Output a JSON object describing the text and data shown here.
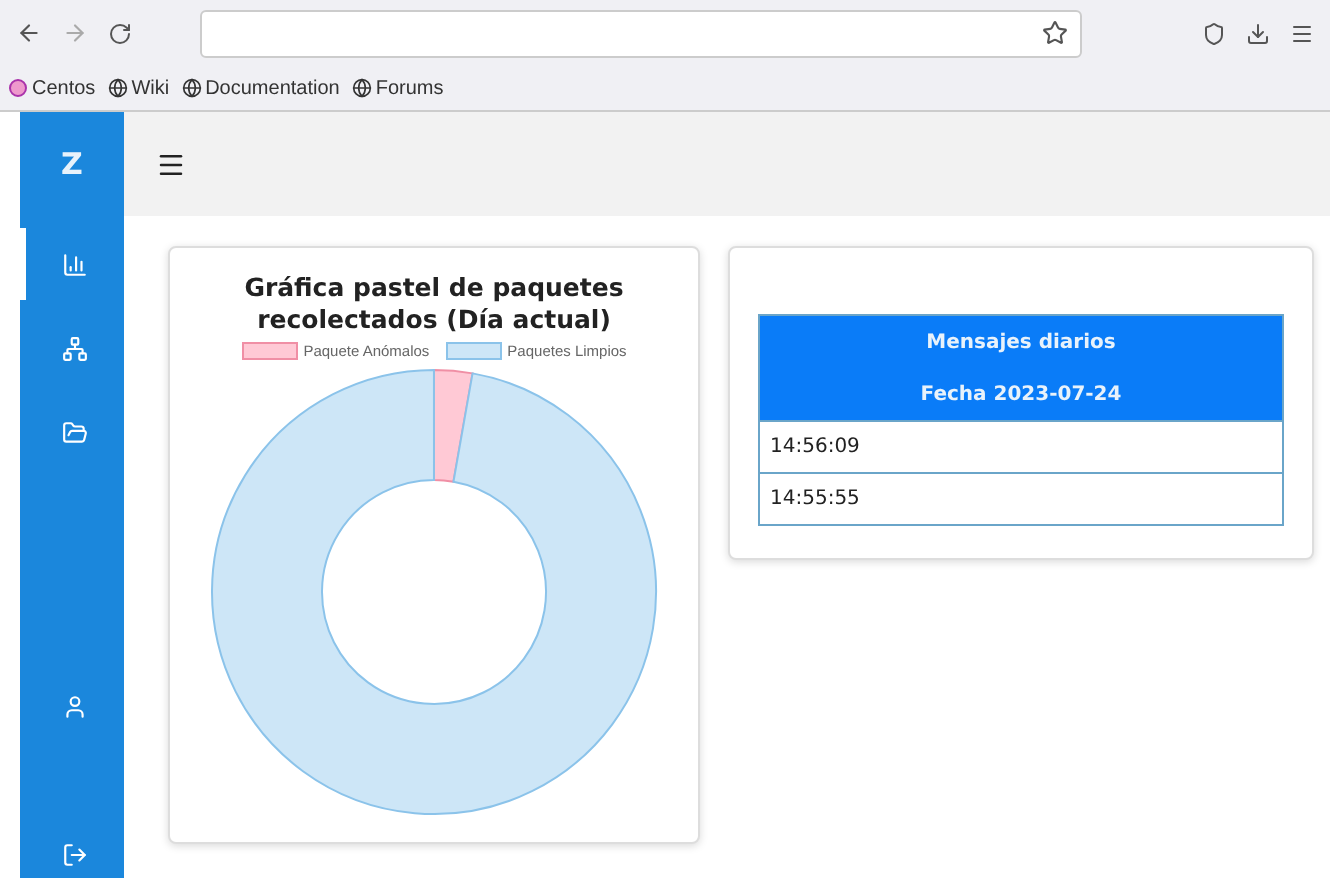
{
  "browser": {
    "bookmarks": [
      {
        "label": "Centos",
        "kind": "centos"
      },
      {
        "label": "Wiki",
        "kind": "globe"
      },
      {
        "label": "Documentation",
        "kind": "globe"
      },
      {
        "label": "Forums",
        "kind": "globe"
      }
    ]
  },
  "sidebar": {
    "logo": "Z",
    "items": [
      {
        "kind": "chart",
        "selected": true
      },
      {
        "kind": "network",
        "selected": false
      },
      {
        "kind": "folder",
        "selected": false
      }
    ],
    "bottom_items": [
      {
        "kind": "user"
      },
      {
        "kind": "logout"
      }
    ]
  },
  "chart_card": {
    "title": "Gráfica pastel de paquetes recolectados (Día actual)",
    "legend": [
      {
        "label": "Paquete Anómalos",
        "color": "#ffc9d5"
      },
      {
        "label": "Paquetes Limpios",
        "color": "#cde6f7"
      }
    ]
  },
  "messages_table": {
    "title": "Mensajes diarios",
    "date": "Fecha 2023-07-24",
    "rows": [
      "14:56:09",
      "14:55:55"
    ]
  }
}
